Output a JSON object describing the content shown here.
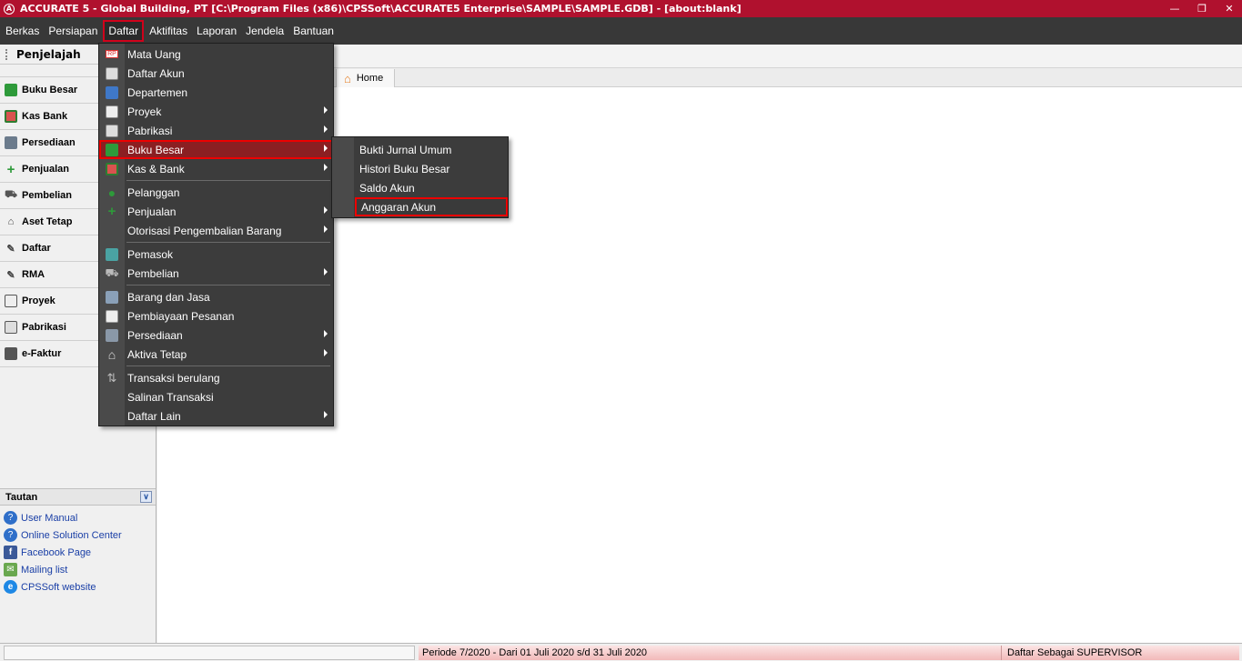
{
  "window": {
    "logo": "A",
    "title": "ACCURATE 5  - Global Building, PT   [C:\\Program Files (x86)\\CPSSoft\\ACCURATE5 Enterprise\\SAMPLE\\SAMPLE.GDB] - [about:blank]",
    "controls": [
      "minimize-icon",
      "restore-icon",
      "close-icon"
    ]
  },
  "menubar": {
    "items": [
      "Berkas",
      "Persiapan",
      "Daftar",
      "Aktifitas",
      "Laporan",
      "Jendela",
      "Bantuan"
    ],
    "active": "Daftar"
  },
  "sidebar": {
    "header": "Penjelajah",
    "items": [
      {
        "label": "Buku Besar",
        "icon": "ledger-icon"
      },
      {
        "label": "Kas Bank",
        "icon": "cash-bank-icon"
      },
      {
        "label": "Persediaan",
        "icon": "inventory-icon"
      },
      {
        "label": "Penjualan",
        "icon": "sales-icon"
      },
      {
        "label": "Pembelian",
        "icon": "cart-icon"
      },
      {
        "label": "Aset Tetap",
        "icon": "house-icon"
      },
      {
        "label": "Daftar",
        "icon": "list-icon"
      },
      {
        "label": "RMA",
        "icon": "rma-icon"
      },
      {
        "label": "Proyek",
        "icon": "project-icon"
      },
      {
        "label": "Pabrikasi",
        "icon": "factory-icon"
      },
      {
        "label": "e-Faktur",
        "icon": "efaktur-icon"
      }
    ]
  },
  "tautan": {
    "header": "Tautan",
    "links": [
      {
        "label": "User Manual",
        "icon": "help-icon"
      },
      {
        "label": "Online Solution Center",
        "icon": "help-icon"
      },
      {
        "label": "Facebook Page",
        "icon": "facebook-icon"
      },
      {
        "label": "Mailing list",
        "icon": "mailing-icon"
      },
      {
        "label": "CPSSoft website",
        "icon": "browser-icon"
      }
    ]
  },
  "content": {
    "tab": {
      "label": "Home",
      "icon": "home-icon"
    }
  },
  "daftar_menu": {
    "items": [
      {
        "label": "Mata Uang",
        "icon": "currency-icon",
        "submenu": false
      },
      {
        "label": "Daftar Akun",
        "icon": "account-list-icon",
        "submenu": false
      },
      {
        "label": "Departemen",
        "icon": "department-icon",
        "submenu": false
      },
      {
        "label": "Proyek",
        "icon": "project-icon",
        "submenu": true
      },
      {
        "label": "Pabrikasi",
        "icon": "factory-icon",
        "submenu": true
      },
      {
        "label": "Buku Besar",
        "icon": "ledger-icon",
        "submenu": true,
        "highlighted": true
      },
      {
        "label": "Kas & Bank",
        "icon": "cash-bank-icon",
        "submenu": true
      },
      {
        "label": "Pelanggan",
        "icon": "customer-icon",
        "submenu": false
      },
      {
        "label": "Penjualan",
        "icon": "sales-icon",
        "submenu": true
      },
      {
        "label": "Otorisasi Pengembalian Barang",
        "icon": "none",
        "submenu": true
      },
      {
        "label": "Pemasok",
        "icon": "supplier-icon",
        "submenu": false
      },
      {
        "label": "Pembelian",
        "icon": "cart-icon",
        "submenu": true
      },
      {
        "label": "Barang dan Jasa",
        "icon": "items-icon",
        "submenu": false
      },
      {
        "label": "Pembiayaan Pesanan",
        "icon": "order-financing-icon",
        "submenu": false
      },
      {
        "label": "Persediaan",
        "icon": "inventory-icon",
        "submenu": true
      },
      {
        "label": "Aktiva Tetap",
        "icon": "house-icon",
        "submenu": true
      },
      {
        "label": "Transaksi berulang",
        "icon": "recurring-icon",
        "submenu": false
      },
      {
        "label": "Salinan Transaksi",
        "icon": "none",
        "submenu": false
      },
      {
        "label": "Daftar Lain",
        "icon": "none",
        "submenu": true
      }
    ]
  },
  "buku_besar_submenu": {
    "items": [
      {
        "label": "Bukti Jurnal Umum"
      },
      {
        "label": "Histori Buku Besar"
      },
      {
        "label": "Saldo Akun"
      },
      {
        "label": "Anggaran Akun",
        "highlighted": true
      }
    ]
  },
  "statusbar": {
    "period": "Periode 7/2020 - Dari 01 Juli 2020 s/d 31 Juli 2020",
    "user": "Daftar Sebagai SUPERVISOR"
  },
  "colors": {
    "titlebar": "#b0112e",
    "menubar": "#383838",
    "menu_bg": "#3c3c3c",
    "highlight_border": "#e00000",
    "link": "#1a3fa6"
  }
}
